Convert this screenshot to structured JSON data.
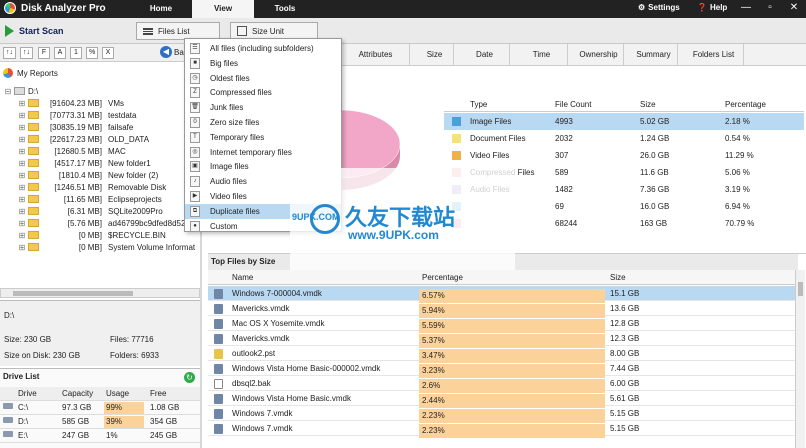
{
  "app": {
    "title": "Disk Analyzer Pro"
  },
  "menu": {
    "tabs": [
      "Home",
      "View",
      "Tools"
    ],
    "active": "View",
    "settings": "Settings",
    "help": "Help"
  },
  "toolbar": {
    "start_scan": "Start Scan",
    "files_list": "Files List",
    "size_unit": "Size Unit"
  },
  "sortbar": {
    "buttons": [
      "F",
      "A",
      "1",
      "%",
      "X"
    ],
    "back": "Ba"
  },
  "tree": {
    "root_label": "My Reports",
    "drive": "D:\\",
    "items": [
      {
        "size": "[91604.23 MB]",
        "name": "VMs"
      },
      {
        "size": "[70773.31 MB]",
        "name": "testdata"
      },
      {
        "size": "[30835.19 MB]",
        "name": "failsafe"
      },
      {
        "size": "[22617.23 MB]",
        "name": "OLD_DATA"
      },
      {
        "size": "[12680.5 MB]",
        "name": "MAC"
      },
      {
        "size": "[4517.17 MB]",
        "name": "New folder1"
      },
      {
        "size": "[1810.4 MB]",
        "name": "New folder (2)"
      },
      {
        "size": "[1246.51 MB]",
        "name": "Removable Disk"
      },
      {
        "size": "[11.65 MB]",
        "name": "Eclipseprojects"
      },
      {
        "size": "[6.31 MB]",
        "name": "SQLite2009Pro"
      },
      {
        "size": "[5.76 MB]",
        "name": "ad46799bc9dfed8d525"
      },
      {
        "size": "[0 MB]",
        "name": "$RECYCLE.BIN"
      },
      {
        "size": "[0 MB]",
        "name": "System Volume Informat"
      }
    ]
  },
  "drive_info": {
    "path": "D:\\",
    "size": "Size: 230 GB",
    "files": "Files: 77716",
    "size_on_disk": "Size on Disk: 230 GB",
    "folders": "Folders: 6933"
  },
  "drive_list": {
    "title": "Drive List",
    "headers": [
      "Drive",
      "Capacity",
      "Usage",
      "Free"
    ],
    "rows": [
      {
        "drive": "C:\\",
        "capacity": "97.3 GB",
        "usage": "99%",
        "free": "1.08 GB"
      },
      {
        "drive": "D:\\",
        "capacity": "585 GB",
        "usage": "39%",
        "free": "354 GB"
      },
      {
        "drive": "E:\\",
        "capacity": "247 GB",
        "usage": "1%",
        "free": "245 GB"
      }
    ]
  },
  "column_headers": [
    "Attributes",
    "Size",
    "Date",
    "Time",
    "Ownership",
    "Summary",
    "Folders List"
  ],
  "dropdown": {
    "items": [
      {
        "label": "All files (including subfolders)",
        "icon": "list-icon"
      },
      {
        "label": "Big files",
        "icon": "big-files-icon"
      },
      {
        "label": "Oldest files",
        "icon": "clock-icon"
      },
      {
        "label": "Compressed files",
        "icon": "zip-icon"
      },
      {
        "label": "Junk files",
        "icon": "trash-icon"
      },
      {
        "label": "Zero size files",
        "icon": "zero-icon"
      },
      {
        "label": "Temporary files",
        "icon": "temp-icon"
      },
      {
        "label": "Internet temporary files",
        "icon": "web-icon"
      },
      {
        "label": "Image files",
        "icon": "image-icon"
      },
      {
        "label": "Audio files",
        "icon": "audio-icon"
      },
      {
        "label": "Video files",
        "icon": "video-icon"
      },
      {
        "label": "Duplicate files",
        "icon": "duplicate-icon"
      },
      {
        "label": "Custom",
        "icon": "custom-icon"
      }
    ],
    "selected": "Duplicate files"
  },
  "type_table": {
    "headers": [
      "Type",
      "File Count",
      "Size",
      "Percentage"
    ],
    "rows": [
      {
        "type": "Image Files",
        "count": "4993",
        "size": "5.02 GB",
        "pct": "2.18 %",
        "color": "#4aa0d8",
        "selected": true
      },
      {
        "type": "Document Files",
        "count": "2032",
        "size": "1.24 GB",
        "pct": "0.54 %",
        "color": "#f5e27a"
      },
      {
        "type": "Video Files",
        "count": "307",
        "size": "26.0 GB",
        "pct": "11.29 %",
        "color": "#f0b04a"
      },
      {
        "type": "Compressed Files",
        "count": "589",
        "size": "11.6 GB",
        "pct": "5.06 %",
        "color": "#f4b6b6"
      },
      {
        "type": "Audio Files",
        "count": "1482",
        "size": "7.36 GB",
        "pct": "3.19 %",
        "color": "#b9a8e0"
      },
      {
        "type": "",
        "count": "69",
        "size": "16.0 GB",
        "pct": "6.94 %",
        "color": "#7cc4d8"
      },
      {
        "type": "",
        "count": "68244",
        "size": "163 GB",
        "pct": "70.79 %",
        "color": "#f2a6c8"
      }
    ]
  },
  "top_files": {
    "title": "Top Files by Size",
    "headers": [
      "Name",
      "Percentage",
      "Size"
    ],
    "rows": [
      {
        "name": "Windows 7-000004.vmdk",
        "pct": "6.57%",
        "size": "15.1 GB",
        "icon": "vmdk",
        "selected": true
      },
      {
        "name": "Mavericks.vmdk",
        "pct": "5.94%",
        "size": "13.6 GB",
        "icon": "vmdk"
      },
      {
        "name": "Mac OS X Yosemite.vmdk",
        "pct": "5.59%",
        "size": "12.8 GB",
        "icon": "vmdk"
      },
      {
        "name": "Mavericks.vmdk",
        "pct": "5.37%",
        "size": "12.3 GB",
        "icon": "vmdk"
      },
      {
        "name": "outlook2.pst",
        "pct": "3.47%",
        "size": "8.00 GB",
        "icon": "pst"
      },
      {
        "name": "Windows Vista Home Basic-000002.vmdk",
        "pct": "3.23%",
        "size": "7.44 GB",
        "icon": "vmdk"
      },
      {
        "name": "dbsql2.bak",
        "pct": "2.6%",
        "size": "6.00 GB",
        "icon": "bak"
      },
      {
        "name": "Windows Vista Home Basic.vmdk",
        "pct": "2.44%",
        "size": "5.61 GB",
        "icon": "vmdk"
      },
      {
        "name": "Windows 7.vmdk",
        "pct": "2.23%",
        "size": "5.15 GB",
        "icon": "vmdk"
      },
      {
        "name": "Windows 7.vmdk",
        "pct": "2.23%",
        "size": "5.15 GB",
        "icon": "vmdk"
      }
    ]
  },
  "watermark": {
    "cn": "久友下载站",
    "url": "www.9UPK.com",
    "small": "9UPK.COM"
  },
  "pie_data": {
    "slices": [
      {
        "value": 70.79,
        "color": "#f2a6c8"
      },
      {
        "value": 11.29,
        "color": "#f0b04a"
      },
      {
        "value": 6.94,
        "color": "#7cc4d8"
      },
      {
        "value": 5.06,
        "color": "#f4b6b6"
      },
      {
        "value": 3.19,
        "color": "#b9a8e0"
      },
      {
        "value": 2.18,
        "color": "#4aa0d8"
      },
      {
        "value": 0.54,
        "color": "#f5e27a"
      }
    ]
  }
}
